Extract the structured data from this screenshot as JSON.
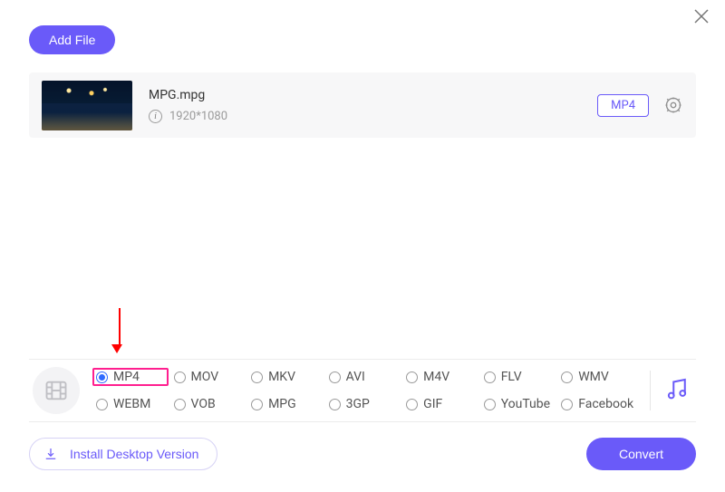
{
  "header": {
    "add_file_label": "Add File"
  },
  "file": {
    "name": "MPG.mpg",
    "dimensions": "1920*1080",
    "target_format_badge": "MP4"
  },
  "formats": {
    "row1": [
      {
        "label": "MP4",
        "selected": true,
        "highlight": true
      },
      {
        "label": "MOV",
        "selected": false,
        "highlight": false
      },
      {
        "label": "MKV",
        "selected": false,
        "highlight": false
      },
      {
        "label": "AVI",
        "selected": false,
        "highlight": false
      },
      {
        "label": "M4V",
        "selected": false,
        "highlight": false
      },
      {
        "label": "FLV",
        "selected": false,
        "highlight": false
      },
      {
        "label": "WMV",
        "selected": false,
        "highlight": false
      }
    ],
    "row2": [
      {
        "label": "WEBM",
        "selected": false,
        "highlight": false
      },
      {
        "label": "VOB",
        "selected": false,
        "highlight": false
      },
      {
        "label": "MPG",
        "selected": false,
        "highlight": false
      },
      {
        "label": "3GP",
        "selected": false,
        "highlight": false
      },
      {
        "label": "GIF",
        "selected": false,
        "highlight": false
      },
      {
        "label": "YouTube",
        "selected": false,
        "highlight": false
      },
      {
        "label": "Facebook",
        "selected": false,
        "highlight": false
      }
    ]
  },
  "footer": {
    "install_label": "Install Desktop Version",
    "convert_label": "Convert"
  },
  "colors": {
    "accent": "#6a5af9",
    "annotation_arrow": "#ff0000",
    "annotation_highlight": "#ff1f8f"
  }
}
